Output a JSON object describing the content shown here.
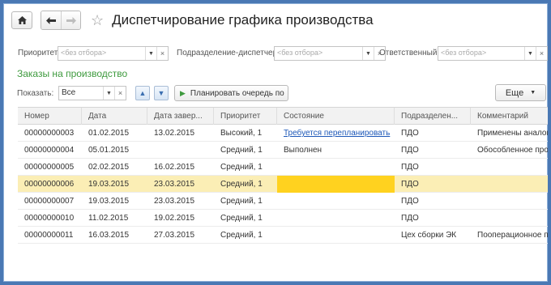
{
  "header": {
    "home_icon": "home-icon",
    "back_icon": "arrow-left-icon",
    "forward_icon": "arrow-right-icon",
    "favorite_icon": "star-icon",
    "title": "Диспетчирование графика производства"
  },
  "filters": {
    "priority_label": "Приоритет:",
    "priority_placeholder": "<без отбора>",
    "department_label": "Подразделение-диспетчер:",
    "department_placeholder": "<без отбора>",
    "responsible_label": "Ответственный:",
    "responsible_placeholder": "<без отбора>",
    "clear_symbol": "×",
    "dropdown_symbol": "▼"
  },
  "section_title": "Заказы на производство",
  "toolbar": {
    "show_label": "Показать:",
    "show_value": "Все",
    "move_up_symbol": "▲",
    "move_down_symbol": "▼",
    "plan_play_symbol": "▶",
    "plan_button": "Планировать очередь по",
    "more_button": "Еще",
    "more_caret": "▼"
  },
  "table": {
    "columns": [
      "Номер",
      "Дата",
      "Дата завер...",
      "Приоритет",
      "Состояние",
      "Подразделен...",
      "Комментарий"
    ],
    "rows": [
      {
        "number": "00000000003",
        "date": "01.02.2015",
        "end_date": "13.02.2015",
        "priority": "Высокий, 1",
        "state": "Требуется перепланировать",
        "department": "ПДО",
        "comment": "Применены аналоги"
      },
      {
        "number": "00000000004",
        "date": "05.01.2015",
        "end_date": "",
        "priority": "Средний, 1",
        "state": "Выполнен",
        "department": "ПДО",
        "comment": "Обособленное прои"
      },
      {
        "number": "00000000005",
        "date": "02.02.2015",
        "end_date": "16.02.2015",
        "priority": "Средний, 1",
        "state": "",
        "department": "ПДО",
        "comment": ""
      },
      {
        "number": "00000000006",
        "date": "19.03.2015",
        "end_date": "23.03.2015",
        "priority": "Средний, 1",
        "state": "",
        "department": "ПДО",
        "comment": ""
      },
      {
        "number": "00000000007",
        "date": "19.03.2015",
        "end_date": "23.03.2015",
        "priority": "Средний, 1",
        "state": "",
        "department": "ПДО",
        "comment": ""
      },
      {
        "number": "00000000010",
        "date": "11.02.2015",
        "end_date": "19.02.2015",
        "priority": "Средний, 1",
        "state": "",
        "department": "ПДО",
        "comment": ""
      },
      {
        "number": "00000000011",
        "date": "16.03.2015",
        "end_date": "27.03.2015",
        "priority": "Средний, 1",
        "state": "",
        "department": "Цех сборки ЭК",
        "comment": "Пооперационное пл"
      }
    ]
  },
  "colors": {
    "frame": "#4a78b4",
    "section_title": "#3d9a3d",
    "selected_row": "#fbeeb5",
    "selected_cell": "#ffd21f",
    "link": "#1d58b8"
  }
}
